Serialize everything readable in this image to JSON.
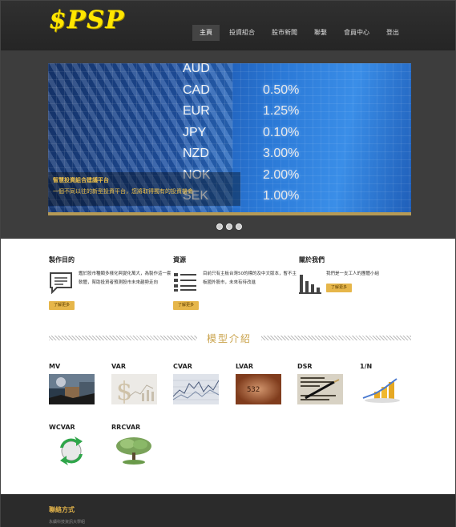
{
  "header": {
    "logo": "$PSP",
    "nav": [
      "主頁",
      "投資組合",
      "股市新聞",
      "聯繫",
      "會員中心",
      "登出"
    ]
  },
  "hero": {
    "rates": [
      {
        "code": "AUD",
        "value": ""
      },
      {
        "code": "CAD",
        "value": "0.50%"
      },
      {
        "code": "EUR",
        "value": "1.25%"
      },
      {
        "code": "JPY",
        "value": "0.10%"
      },
      {
        "code": "NZD",
        "value": "3.00%"
      },
      {
        "code": "NOK",
        "value": "2.00%"
      },
      {
        "code": "SEK",
        "value": "1.00%"
      }
    ],
    "caption_title": "智慧投資組合建議平台",
    "caption_sub": "一個不同以往的新型投資平台，您將取得獨有的投資機會"
  },
  "features": [
    {
      "title": "製作目的",
      "text": "鑑於股市種類多樣化與變化萬大，為製作這一套軟體，幫助投資者預測股市未來趨勢走向",
      "button": "了解更多",
      "icon": "chat-bubble-icon"
    },
    {
      "title": "資源",
      "text": "目前只有主板台灣50的標的及中文版本，暫不主板國外股市，未來有待改進",
      "button": "了解更多",
      "icon": "list-icon"
    },
    {
      "title": "關於我們",
      "text": "我們是一支工人的團體小組",
      "button": "了解更多",
      "icon": "bar-chart-icon"
    }
  ],
  "models": {
    "title": "模型介紹",
    "items": [
      "MV",
      "VAR",
      "CVAR",
      "LVAR",
      "DSR",
      "1/N",
      "WCVAR",
      "RRCVAR"
    ]
  },
  "footer": {
    "title": "聯絡方式",
    "subtitle": "永續科技資訊大學組"
  }
}
